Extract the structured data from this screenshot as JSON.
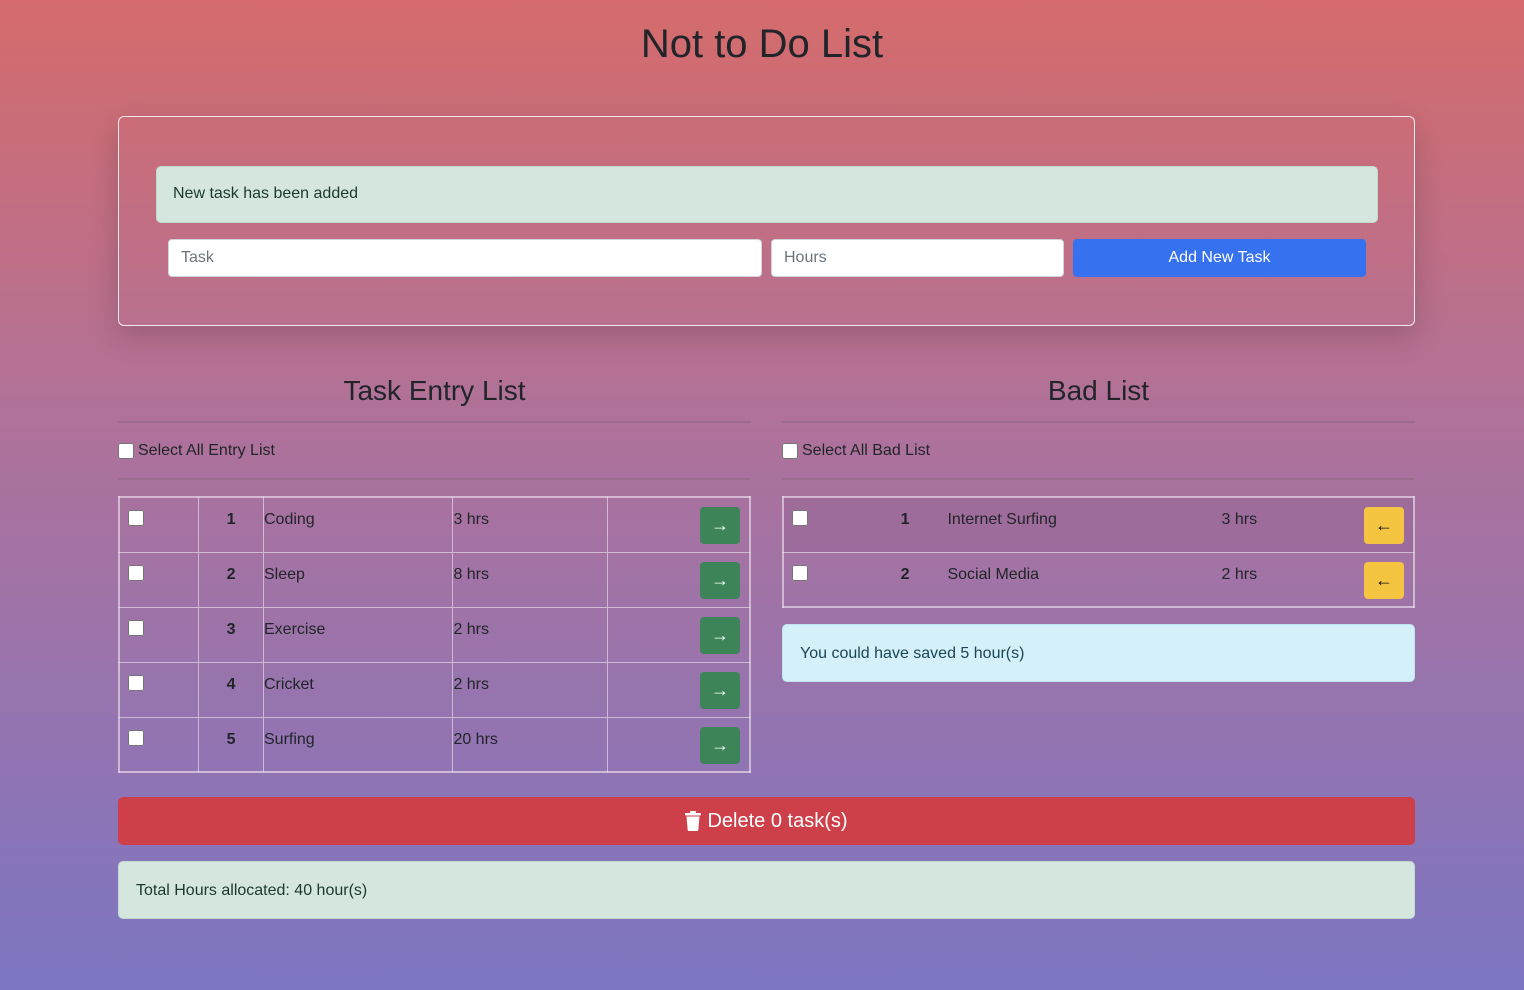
{
  "header": {
    "title": "Not to Do List"
  },
  "form": {
    "alert": "New task has been added",
    "task_placeholder": "Task",
    "hours_placeholder": "Hours",
    "add_button": "Add New Task"
  },
  "entry_list": {
    "heading": "Task Entry List",
    "select_all": "Select All Entry List",
    "rows": [
      {
        "num": "1",
        "task": "Coding",
        "hours": "3 hrs"
      },
      {
        "num": "2",
        "task": "Sleep",
        "hours": "8 hrs"
      },
      {
        "num": "3",
        "task": "Exercise",
        "hours": "2 hrs"
      },
      {
        "num": "4",
        "task": "Cricket",
        "hours": "2 hrs"
      },
      {
        "num": "5",
        "task": "Surfing",
        "hours": "20 hrs"
      }
    ]
  },
  "bad_list": {
    "heading": "Bad List",
    "select_all": "Select All Bad List",
    "rows": [
      {
        "num": "1",
        "task": "Internet Surfing",
        "hours": "3 hrs"
      },
      {
        "num": "2",
        "task": "Social Media",
        "hours": "2 hrs"
      }
    ],
    "saved_alert": "You could have saved 5 hour(s)"
  },
  "delete_button": "Delete 0 task(s)",
  "total_alert": "Total Hours allocated: 40 hour(s)",
  "colors": {
    "add_button": "#3671f0",
    "move_right": "#3d8558",
    "move_left": "#f5c542",
    "delete": "#cd404a"
  },
  "icons": {
    "move_right": "arrow-right-icon",
    "move_left": "arrow-left-icon",
    "delete": "trash-icon"
  }
}
